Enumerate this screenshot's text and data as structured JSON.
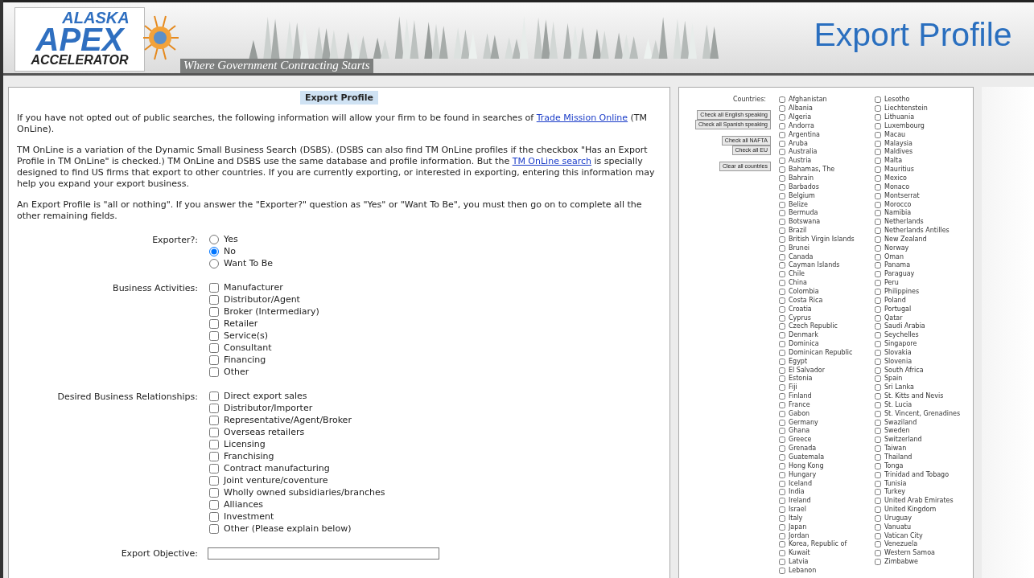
{
  "header": {
    "logo": {
      "line_1": "ALASKA",
      "line_2": "APEX",
      "line_3": "ACCELERATOR"
    },
    "tagline": "Where Government Contracting Starts",
    "title": "Export Profile"
  },
  "form": {
    "heading": "Export Profile",
    "paragraphs": [
      [
        {
          "text": "If you have not opted out of public searches, the following information will allow your firm to be found in searches of "
        },
        {
          "link": "Trade Mission Online"
        },
        {
          "text": " (TM OnLine)."
        }
      ],
      [
        {
          "text": "TM OnLine is a variation of the Dynamic Small Business Search (DSBS). (DSBS can also find TM OnLine profiles if the checkbox \"Has an Export Profile in TM OnLine\" is checked.) TM OnLine and DSBS use the same database and profile information. But the "
        },
        {
          "link": "TM OnLine search"
        },
        {
          "text": " is specially designed to find US firms that export to other countries. If you are currently exporting, or interested in exporting, entering this information may help you expand your export business."
        }
      ],
      [
        {
          "text": "An Export Profile is \"all or nothing\". If you answer the \"Exporter?\" question as \"Yes\" or \"Want To Be\", you must then go on to complete all the other remaining fields."
        }
      ]
    ],
    "fields": [
      {
        "kind": "radio",
        "label": "Exporter?:",
        "options": [
          {
            "label": "Yes",
            "selected": false
          },
          {
            "label": "No",
            "selected": true
          },
          {
            "label": "Want To Be",
            "selected": false
          }
        ]
      },
      {
        "kind": "checkbox",
        "label": "Business Activities:",
        "options": [
          {
            "label": "Manufacturer",
            "checked": false
          },
          {
            "label": "Distributor/Agent",
            "checked": false
          },
          {
            "label": "Broker (Intermediary)",
            "checked": false
          },
          {
            "label": "Retailer",
            "checked": false
          },
          {
            "label": "Service(s)",
            "checked": false
          },
          {
            "label": "Consultant",
            "checked": false
          },
          {
            "label": "Financing",
            "checked": false
          },
          {
            "label": "Other",
            "checked": false
          }
        ]
      },
      {
        "kind": "checkbox",
        "label": "Desired Business Relationships:",
        "options": [
          {
            "label": "Direct export sales",
            "checked": false
          },
          {
            "label": "Distributor/Importer",
            "checked": false
          },
          {
            "label": "Representative/Agent/Broker",
            "checked": false
          },
          {
            "label": "Overseas retailers",
            "checked": false
          },
          {
            "label": "Licensing",
            "checked": false
          },
          {
            "label": "Franchising",
            "checked": false
          },
          {
            "label": "Contract manufacturing",
            "checked": false
          },
          {
            "label": "Joint venture/coventure",
            "checked": false
          },
          {
            "label": "Wholly owned subsidiaries/branches",
            "checked": false
          },
          {
            "label": "Alliances",
            "checked": false
          },
          {
            "label": "Investment",
            "checked": false
          },
          {
            "label": "Other (Please explain below)",
            "checked": false
          }
        ]
      },
      {
        "kind": "text",
        "label": "Export Objective:"
      }
    ]
  },
  "countries": {
    "label": "Countries:",
    "button_groups": [
      [
        "Check all English speaking",
        "Check all Spanish speaking"
      ],
      [
        "Check all NAFTA",
        "Check all EU"
      ],
      [
        "Clear all countries"
      ]
    ],
    "columns": [
      [
        {
          "name": "Afghanistan",
          "checked": false
        },
        {
          "name": "Albania",
          "checked": false
        },
        {
          "name": "Algeria",
          "checked": false
        },
        {
          "name": "Andorra",
          "checked": false
        },
        {
          "name": "Argentina",
          "checked": false
        },
        {
          "name": "Aruba",
          "checked": false
        },
        {
          "name": "Australia",
          "checked": false
        },
        {
          "name": "Austria",
          "checked": false
        },
        {
          "name": "Bahamas, The",
          "checked": false
        },
        {
          "name": "Bahrain",
          "checked": false
        },
        {
          "name": "Barbados",
          "checked": false
        },
        {
          "name": "Belgium",
          "checked": false
        },
        {
          "name": "Belize",
          "checked": false
        },
        {
          "name": "Bermuda",
          "checked": false
        },
        {
          "name": "Botswana",
          "checked": false
        },
        {
          "name": "Brazil",
          "checked": false
        },
        {
          "name": "British Virgin Islands",
          "checked": false
        },
        {
          "name": "Brunei",
          "checked": false
        },
        {
          "name": "Canada",
          "checked": false
        },
        {
          "name": "Cayman Islands",
          "checked": false
        },
        {
          "name": "Chile",
          "checked": false
        },
        {
          "name": "China",
          "checked": false
        },
        {
          "name": "Colombia",
          "checked": false
        },
        {
          "name": "Costa Rica",
          "checked": false
        },
        {
          "name": "Croatia",
          "checked": false
        },
        {
          "name": "Cyprus",
          "checked": false
        },
        {
          "name": "Czech Republic",
          "checked": false
        },
        {
          "name": "Denmark",
          "checked": false
        },
        {
          "name": "Dominica",
          "checked": false
        },
        {
          "name": "Dominican Republic",
          "checked": false
        },
        {
          "name": "Egypt",
          "checked": false
        },
        {
          "name": "El Salvador",
          "checked": false
        },
        {
          "name": "Estonia",
          "checked": false
        },
        {
          "name": "Fiji",
          "checked": false
        },
        {
          "name": "Finland",
          "checked": false
        },
        {
          "name": "France",
          "checked": false
        },
        {
          "name": "Gabon",
          "checked": false
        },
        {
          "name": "Germany",
          "checked": false
        },
        {
          "name": "Ghana",
          "checked": false
        },
        {
          "name": "Greece",
          "checked": false
        },
        {
          "name": "Grenada",
          "checked": false
        },
        {
          "name": "Guatemala",
          "checked": false
        },
        {
          "name": "Hong Kong",
          "checked": false
        },
        {
          "name": "Hungary",
          "checked": false
        },
        {
          "name": "Iceland",
          "checked": false
        },
        {
          "name": "India",
          "checked": false
        },
        {
          "name": "Ireland",
          "checked": false
        },
        {
          "name": "Israel",
          "checked": false
        },
        {
          "name": "Italy",
          "checked": false
        },
        {
          "name": "Japan",
          "checked": false
        },
        {
          "name": "Jordan",
          "checked": false
        },
        {
          "name": "Korea, Republic of",
          "checked": false
        },
        {
          "name": "Kuwait",
          "checked": false
        },
        {
          "name": "Latvia",
          "checked": false
        },
        {
          "name": "Lebanon",
          "checked": false
        }
      ],
      [
        {
          "name": "Lesotho",
          "checked": false
        },
        {
          "name": "Liechtenstein",
          "checked": false
        },
        {
          "name": "Lithuania",
          "checked": false
        },
        {
          "name": "Luxembourg",
          "checked": false
        },
        {
          "name": "Macau",
          "checked": false
        },
        {
          "name": "Malaysia",
          "checked": false
        },
        {
          "name": "Maldives",
          "checked": false
        },
        {
          "name": "Malta",
          "checked": false
        },
        {
          "name": "Mauritius",
          "checked": false
        },
        {
          "name": "Mexico",
          "checked": false
        },
        {
          "name": "Monaco",
          "checked": false
        },
        {
          "name": "Montserrat",
          "checked": false
        },
        {
          "name": "Morocco",
          "checked": false
        },
        {
          "name": "Namibia",
          "checked": false
        },
        {
          "name": "Netherlands",
          "checked": false
        },
        {
          "name": "Netherlands Antilles",
          "checked": false
        },
        {
          "name": "New Zealand",
          "checked": false
        },
        {
          "name": "Norway",
          "checked": false
        },
        {
          "name": "Oman",
          "checked": false
        },
        {
          "name": "Panama",
          "checked": false
        },
        {
          "name": "Paraguay",
          "checked": false
        },
        {
          "name": "Peru",
          "checked": false
        },
        {
          "name": "Philippines",
          "checked": false
        },
        {
          "name": "Poland",
          "checked": false
        },
        {
          "name": "Portugal",
          "checked": false
        },
        {
          "name": "Qatar",
          "checked": false
        },
        {
          "name": "Saudi Arabia",
          "checked": false
        },
        {
          "name": "Seychelles",
          "checked": false
        },
        {
          "name": "Singapore",
          "checked": false
        },
        {
          "name": "Slovakia",
          "checked": false
        },
        {
          "name": "Slovenia",
          "checked": false
        },
        {
          "name": "South Africa",
          "checked": false
        },
        {
          "name": "Spain",
          "checked": false
        },
        {
          "name": "Sri Lanka",
          "checked": false
        },
        {
          "name": "St. Kitts and Nevis",
          "checked": false
        },
        {
          "name": "St. Lucia",
          "checked": false
        },
        {
          "name": "St. Vincent, Grenadines",
          "checked": false
        },
        {
          "name": "Swaziland",
          "checked": false
        },
        {
          "name": "Sweden",
          "checked": false
        },
        {
          "name": "Switzerland",
          "checked": false
        },
        {
          "name": "Taiwan",
          "checked": false
        },
        {
          "name": "Thailand",
          "checked": false
        },
        {
          "name": "Tonga",
          "checked": false
        },
        {
          "name": "Trinidad and Tobago",
          "checked": false
        },
        {
          "name": "Tunisia",
          "checked": false
        },
        {
          "name": "Turkey",
          "checked": false
        },
        {
          "name": "United Arab Emirates",
          "checked": false
        },
        {
          "name": "United Kingdom",
          "checked": false
        },
        {
          "name": "Uruguay",
          "checked": false
        },
        {
          "name": "Vanuatu",
          "checked": false
        },
        {
          "name": "Vatican City",
          "checked": false
        },
        {
          "name": "Venezuela",
          "checked": false
        },
        {
          "name": "Western Samoa",
          "checked": false
        },
        {
          "name": "Zimbabwe",
          "checked": false
        }
      ]
    ]
  }
}
